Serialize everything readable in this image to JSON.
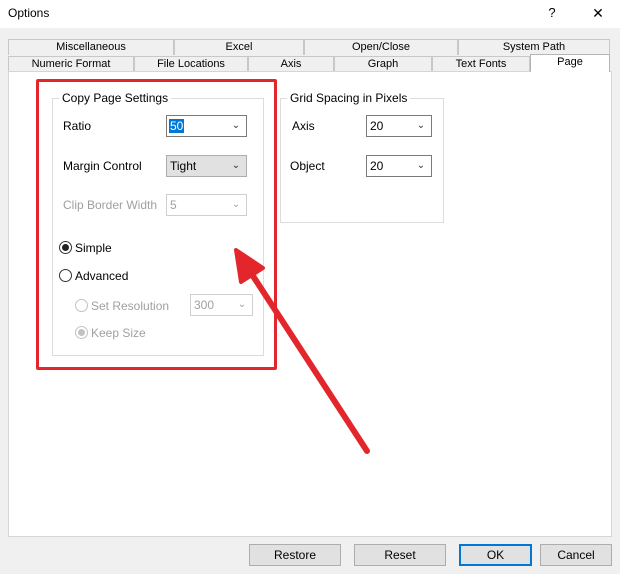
{
  "window": {
    "title": "Options",
    "help": "?",
    "close": "✕"
  },
  "tabs_row1": [
    "Miscellaneous",
    "Excel",
    "Open/Close",
    "System Path"
  ],
  "tabs_row2": [
    "Numeric Format",
    "File Locations",
    "Axis",
    "Graph",
    "Text Fonts",
    "Page"
  ],
  "active_tab": "Page",
  "copy_page": {
    "legend": "Copy Page Settings",
    "ratio": {
      "label": "Ratio",
      "value": "50"
    },
    "margin": {
      "label": "Margin Control",
      "value": "Tight"
    },
    "clip": {
      "label": "Clip Border Width",
      "value": "5"
    },
    "simple": {
      "label": "Simple",
      "checked": true
    },
    "advanced": {
      "label": "Advanced",
      "checked": false
    },
    "set_resolution": {
      "label": "Set Resolution",
      "value": "300"
    },
    "keep_size": {
      "label": "Keep Size",
      "checked": true
    }
  },
  "grid_spacing": {
    "legend": "Grid Spacing in Pixels",
    "axis": {
      "label": "Axis",
      "value": "20"
    },
    "object": {
      "label": "Object",
      "value": "20"
    }
  },
  "buttons": {
    "restore": "Restore",
    "reset": "Reset",
    "ok": "OK",
    "cancel": "Cancel"
  },
  "annotation": {
    "highlight_color": "#e3262b"
  }
}
